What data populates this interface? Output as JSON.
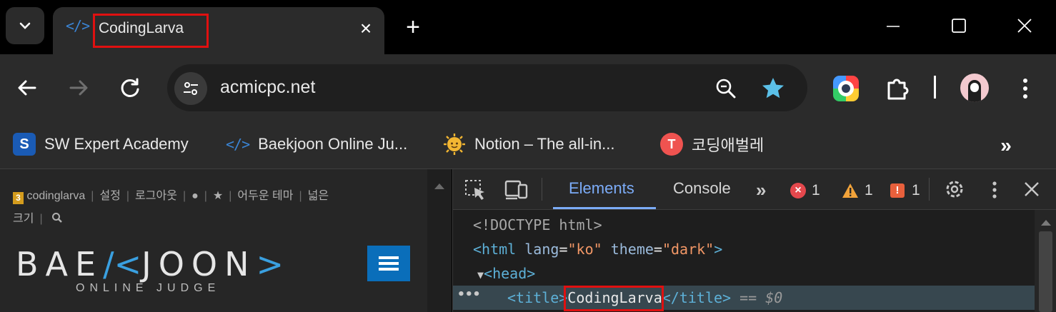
{
  "tab": {
    "title": "CodingLarva",
    "favicon": "</>"
  },
  "toolbar": {
    "url": "acmicpc.net"
  },
  "bookmarks": [
    {
      "label": "SW Expert Academy",
      "icon": "S"
    },
    {
      "label": "Baekjoon Online Ju...",
      "icon": "</>"
    },
    {
      "label": "Notion – The all-in...",
      "icon": "notion-icon"
    },
    {
      "label": "코딩애벌레",
      "icon": "T"
    }
  ],
  "page": {
    "nav": [
      "codinglarva",
      "설정",
      "로그아웃",
      "어두운 테마",
      "넓은",
      "크기"
    ],
    "badge": "3",
    "logo_left": "BAE",
    "logo_mark": "/<",
    "logo_right": "JOON",
    "logo_end": ">",
    "logo_sub": "ONLINE JUDGE"
  },
  "devtools": {
    "tabs": {
      "elements": "Elements",
      "console": "Console"
    },
    "errors": "1",
    "warnings": "1",
    "issues": "1",
    "tree": {
      "doctype": "<!DOCTYPE html>",
      "html_open": "<html",
      "lang_attr": "lang",
      "lang_val": "\"ko\"",
      "theme_attr": "theme",
      "theme_val": "\"dark\"",
      "html_close": ">",
      "head": "<head>",
      "title_open": "<title>",
      "title_text": "CodingLarva",
      "title_close": "</title>",
      "eq": "== $0"
    }
  },
  "colors": {
    "highlight_box": "#e01010",
    "accent": "#7cacf8",
    "brand_blue": "#0a6eba"
  }
}
